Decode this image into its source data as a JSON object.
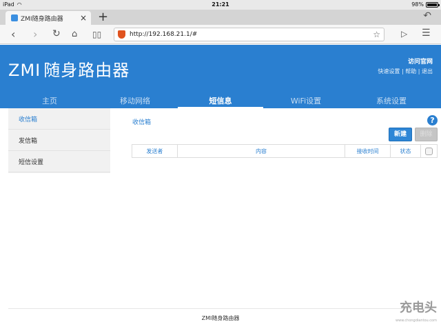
{
  "status": {
    "device": "iPad",
    "time": "21:21",
    "battery": "98%",
    "battery_level": 0.98
  },
  "browser": {
    "tab_title": "ZMI随身路由器",
    "url": "http://192.168.21.1/#"
  },
  "header": {
    "logo_latin": "ZMI",
    "logo_cn": "随身路由器",
    "visit_site": "访问官网",
    "quick_setup": "快速设置",
    "help": "帮助",
    "logout": "退出",
    "separator": "|"
  },
  "nav": [
    {
      "label": "主页"
    },
    {
      "label": "移动网络"
    },
    {
      "label": "短信息"
    },
    {
      "label": "WiFi设置"
    },
    {
      "label": "系统设置"
    }
  ],
  "sidebar": [
    {
      "label": "收信箱"
    },
    {
      "label": "发信箱"
    },
    {
      "label": "短信设置"
    }
  ],
  "main": {
    "title": "收信箱",
    "help_label": "?",
    "new_button": "新建",
    "delete_button": "删除",
    "columns": [
      "发送者",
      "内容",
      "接收时间",
      "状态"
    ]
  },
  "footer": {
    "text": "ZMI随身路由器"
  },
  "watermark": {
    "text": "充电头",
    "url": "www.chongdiantou.com"
  },
  "colors": {
    "brand": "#2a7fd0",
    "sidebar_bg": "#f1f1f1"
  }
}
